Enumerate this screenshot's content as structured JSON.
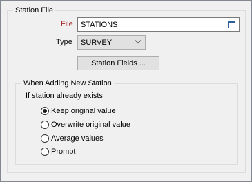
{
  "station_file_group": {
    "title": "Station File",
    "file_label": "File",
    "file_value": "STATIONS",
    "browse_icon": "browse-table-icon",
    "type_label": "Type",
    "type_value": "SURVEY",
    "station_fields_button": "Station Fields ..."
  },
  "adding_group": {
    "title": "When Adding New Station",
    "prompt_text": "If station already exists",
    "options": [
      {
        "label": "Keep original value",
        "checked": true
      },
      {
        "label": "Overwrite original value",
        "checked": false
      },
      {
        "label": "Average values",
        "checked": false
      },
      {
        "label": "Prompt",
        "checked": false
      }
    ]
  },
  "colors": {
    "background": "#f0f0f0",
    "file_label": "#a52a2a",
    "border": "#dcdcdc"
  }
}
